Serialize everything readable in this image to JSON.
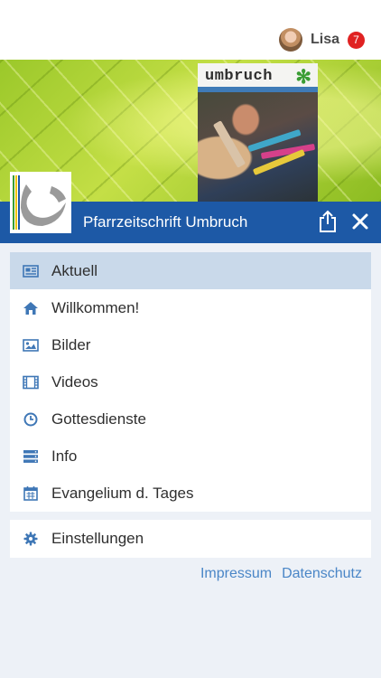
{
  "header": {
    "user_name": "Lisa",
    "notification_count": "7"
  },
  "hero": {
    "magazine_title": "umbruch"
  },
  "titlebar": {
    "title": "Pfarrzeitschrift Umbruch"
  },
  "menu": {
    "items": [
      {
        "label": "Aktuell",
        "icon": "newspaper-icon",
        "active": true
      },
      {
        "label": "Willkommen!",
        "icon": "home-icon"
      },
      {
        "label": "Bilder",
        "icon": "image-icon"
      },
      {
        "label": "Videos",
        "icon": "film-icon"
      },
      {
        "label": "Gottesdienste",
        "icon": "clock-icon"
      },
      {
        "label": "Info",
        "icon": "server-list-icon"
      },
      {
        "label": "Evangelium d. Tages",
        "icon": "calendar-icon"
      }
    ],
    "settings_label": "Einstellungen",
    "settings_icon": "gear-icon"
  },
  "footer": {
    "impressum": "Impressum",
    "datenschutz": "Datenschutz"
  },
  "colors": {
    "primary": "#1d59a6",
    "active_row": "#c9d9ea",
    "icon": "#3f77b6",
    "badge": "#e02222",
    "link": "#4a86c7"
  }
}
